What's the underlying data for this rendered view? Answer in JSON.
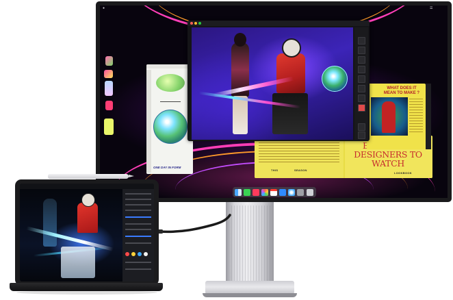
{
  "menubar": {
    "left_items": [
      "",
      "",
      "",
      "",
      "",
      ""
    ],
    "clock": ""
  },
  "magazine": {
    "question": "WHAT DOES IT MEAN TO MAKE ?",
    "headline": "EMERGING DESIGNERS TO WATCH",
    "this_label": "THIS",
    "season_label": "SEASON",
    "lookbook_label": "LOOKBOOK"
  },
  "sketch": {
    "caption": "ONE DAY IN FORM"
  },
  "dock_icons": [
    "finder-icon",
    "messages-icon",
    "music-icon",
    "photos-icon",
    "calendar-icon",
    "mail-icon",
    "safari-icon",
    "settings-icon",
    "trash-icon"
  ],
  "colors": {
    "wallpaper_magenta": "#ff2fb0",
    "wallpaper_orange": "#ff8a1f",
    "wallpaper_purple": "#7a1ccf",
    "magazine_yellow": "#f0e24a",
    "magazine_red": "#c62d2d",
    "art_purple": "#3b1a9a"
  }
}
